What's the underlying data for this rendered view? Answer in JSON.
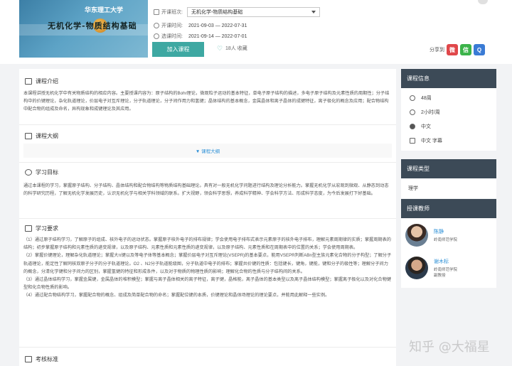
{
  "cover": {
    "logo_text": "华东理工大学",
    "title_text": "无机化学-物质结构基础"
  },
  "course": {
    "class_label": "开课班次:",
    "class_value": "无机化学-物质结构基础",
    "start_label": "开课时间:",
    "start_value": "2021-09-03 — 2022-07-31",
    "select_label": "选课时间:",
    "select_value": "2021-09-14 — 2022-07-01",
    "join_button": "加入课程",
    "fav_text": "18人 收藏"
  },
  "share": {
    "label": "分享到",
    "icons": [
      "weibo-icon",
      "wechat-icon",
      "qzone-icon"
    ]
  },
  "sections": {
    "intro_title": "课程介绍",
    "intro_body": "本课程讲授无机化学中有关物质结构的相应内容。主要授课内容为：原子结构的Bohr理论，微观粒子运动的基本特征，单电子原子结构的描述，多电子原子结构及元素性质的周期性；分子结构中的价键理论，杂化轨道理论，价层电子对互斥理论，分子轨道理论，分子间作用力和氢键；晶体结构的基本概念，金属晶体和离子晶体的成键特征，离子极化的概念及应用；配合物结构中配合物的组成及命名，异构现象和成键理论及其应用。",
    "outline_title": "课程大纲",
    "outline_link": "▼ 课程大纲",
    "goal_title": "学习目标",
    "goal_body": "通过本课程的学习，掌握原子结构、分子结构、晶体结构和配合物结构等物质结构基础理论。具有对一般无机化学问题进行结构及理论分析能力。掌握无机化学从宏观到微观、从静态到动态的科学研究历程，了解无机化学发展历史，认识无机化学与相关学科领域的联系。扩大视野，领会科学思想，养成科学精神、学会科学方法、形成科学态度，为今后发展打下好基础。",
    "req_title": "学习要求",
    "req_items": [
      "（1）通过原子结构学习，了解原子的组成、核外电子的运动状态。掌握原子核外电子的排布规律；学会使用电子排布式表示元素原子的核外电子排布，理解元素周期律的实质；掌握周期表的结构；初步掌握原子结构和元素性质的递变规律，以及原子结构、元素性质和元素性质的递变规律，以及原子结构、元素性质和在周期表中的位置的关系；学会使用周期表。",
      "（2）掌握价键理论，理解杂化轨道理论；掌握大π键以及等电子体等基本概念；掌握价层电子对互斥理论(VSEPR)的基本要点，能用VSEPR判断ABn型主族元素化合物的分子构型；了解分子轨道理论，能定性了解同核双原子分子的分子轨道理论。O2 、N2分子轨道能级图，分子轨道中电子的排布；掌握共价键的性质：包括键长，键角，键能，键和分子的极性等；理解分子间力的概念，分清化学键和分子间力的区别，掌握氢键的特征和形成条件，以及对于物质的物理性质的影响；理解化合物的性质与分子结构间的关系。",
      "（3）通过晶体结构学习，掌握金属键，金属晶体的堆积模型；掌握与离子晶体相关的离子特征，离子键，晶格能，离子晶体的基本类型以及离子晶体结构模型；掌握离子极化以及对化合物键型和化合物性质的影响。",
      "（4）通过配合物结构学习，掌握配合物的概念、组成及简单配合物的命名；掌握配位键的本质，价键理论和晶体场理论的理论要点，并能用此解释一些实例。"
    ],
    "exam_title": "考核标准"
  },
  "sidebar": {
    "info_title": "课程信息",
    "info_items": [
      {
        "icon": "clock-icon",
        "text": "48周"
      },
      {
        "icon": "timer-icon",
        "text": "2小时/周"
      },
      {
        "icon": "globe-icon",
        "text": "中文"
      },
      {
        "icon": "subtitle-icon",
        "text": "中文 字幕"
      }
    ],
    "type_title": "课程类型",
    "type_value": "理学",
    "teacher_title": "授课教师",
    "teachers": [
      {
        "name": "陈静",
        "org": "岭南师范学院"
      },
      {
        "name": "谢木标",
        "org": "岭南师范学院\n副教授"
      }
    ]
  },
  "watermark": "知乎 @大福星"
}
